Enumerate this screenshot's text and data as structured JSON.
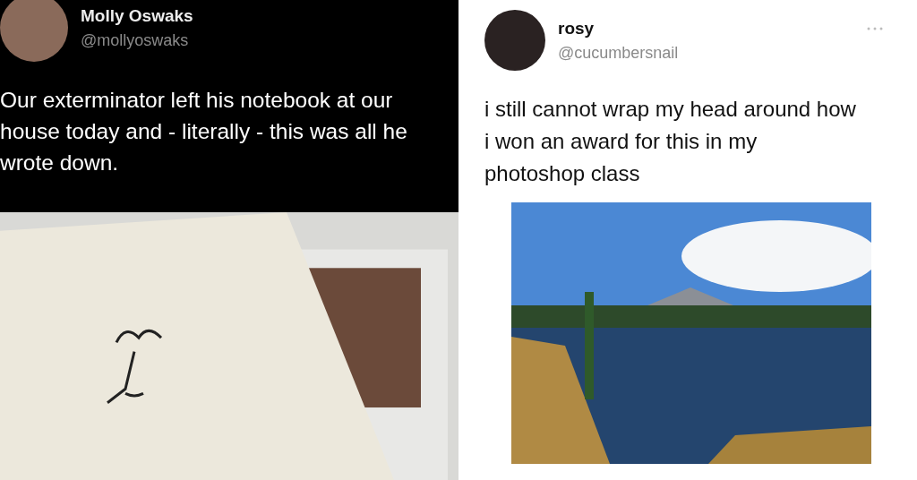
{
  "tweets": [
    {
      "kind": "dark",
      "name": "Molly Oswaks",
      "handle": "@mollyoswaks",
      "text": "Our exterminator left his notebook at our house today and - literally - this was all he wrote down."
    },
    {
      "kind": "light",
      "name": "rosy",
      "handle": "@cucumbersnail",
      "text": "i still cannot wrap my head around how i won an award for this in my photoshop class"
    }
  ]
}
